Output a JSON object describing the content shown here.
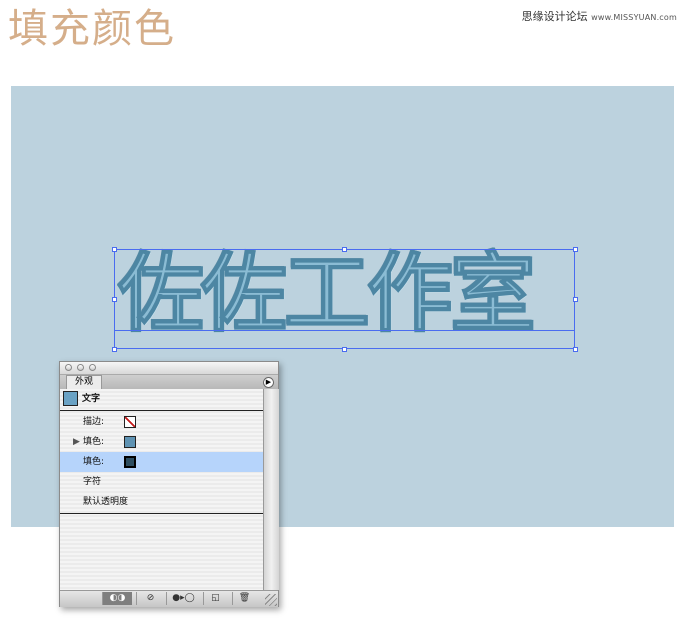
{
  "header": {
    "title": "填充颜色",
    "site": "思缘设计论坛",
    "url": "www.MISSYUAN.com"
  },
  "canvas": {
    "text": "佐佐工作室",
    "background": "#bcd2de",
    "text_color": "#8bbcd4",
    "selection_color": "#4a6cf0"
  },
  "panel": {
    "tab_label": "外观",
    "menu_icon": "▶",
    "object_label": "文字",
    "rows": [
      {
        "label": "描边:",
        "swatch": "none-stroke"
      },
      {
        "label": "填色:",
        "swatch": "#5f93b3"
      },
      {
        "label": "填色:",
        "swatch": "#2d4d60"
      },
      {
        "label": "字符"
      },
      {
        "label": "默认透明度"
      }
    ],
    "bottom_buttons": [
      "◐◑",
      "⊘",
      "●▸◯",
      "◱",
      "🗑"
    ],
    "selected_row_color": "#b6d4fb"
  }
}
